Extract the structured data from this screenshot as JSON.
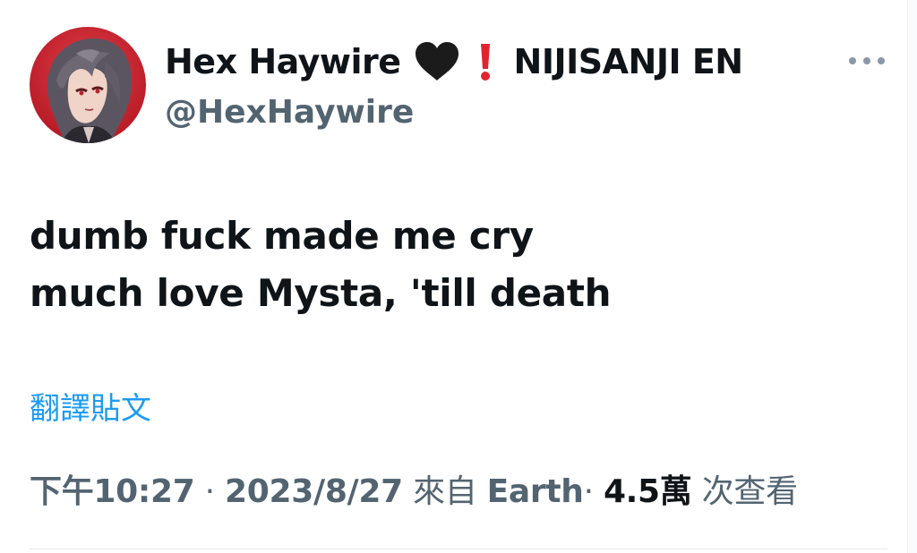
{
  "tweet": {
    "author": {
      "display_name": "Hex Haywire",
      "name_emojis": [
        "black-heart-icon",
        "red-exclamation-icon"
      ],
      "affiliation": "NIJISANJI EN",
      "handle": "@HexHaywire"
    },
    "text_lines": [
      "dumb fuck made me cry",
      "much love Mysta, 'till death"
    ],
    "translate_label": "翻譯貼文",
    "meta": {
      "time": "下午10:27",
      "separator": "·",
      "date": "2023/8/27",
      "source_prefix": "來自",
      "source": "Earth",
      "views_count": "4.5萬",
      "views_label": "次查看"
    }
  },
  "colors": {
    "text_primary": "#0f1419",
    "text_secondary": "#536471",
    "link": "#1d9bf0",
    "heart": "#1b1b1b",
    "exclamation": "#e0242e"
  }
}
